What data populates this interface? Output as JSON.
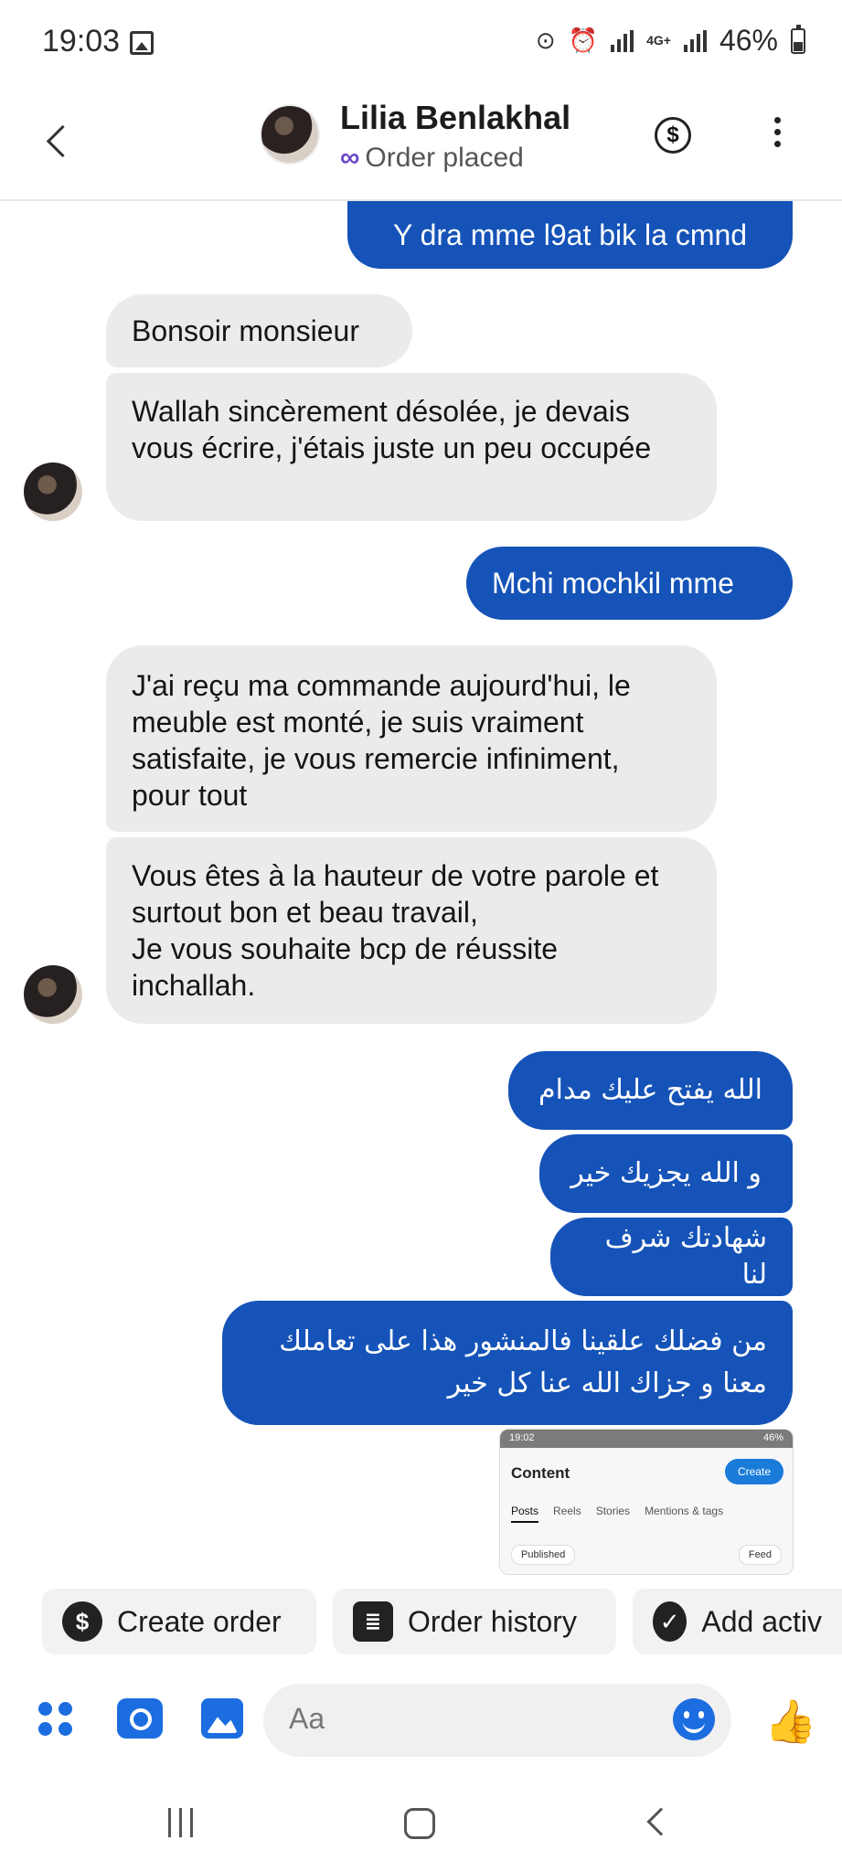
{
  "status": {
    "time": "19:03",
    "net_label": "4G+",
    "battery": "46%"
  },
  "header": {
    "name": "Lilia Benlakhal",
    "subtitle": "Order placed"
  },
  "messages": [
    {
      "dir": "out",
      "text": "Y dra mme l9at bik la cmnd"
    },
    {
      "dir": "in",
      "text": "Bonsoir monsieur"
    },
    {
      "dir": "in",
      "text": "Wallah sincèrement désolée, je devais vous écrire, j'étais juste un peu occupée"
    },
    {
      "dir": "out",
      "text": "Mchi mochkil mme"
    },
    {
      "dir": "in",
      "text": "J'ai reçu ma commande aujourd'hui, le meuble est monté, je suis vraiment satisfaite, je vous remercie infiniment, pour tout"
    },
    {
      "dir": "in",
      "text": "Vous êtes à la hauteur de votre parole et surtout bon et beau travail,\nJe vous souhaite bcp de réussite inchallah."
    },
    {
      "dir": "out",
      "text": "الله يفتح عليك مدام"
    },
    {
      "dir": "out",
      "text": "و الله يجزيك خير"
    },
    {
      "dir": "out",
      "text": "شهادتك شرف لنا"
    },
    {
      "dir": "out",
      "text": "من فضلك علقينا فالمنشور هذا على تعاملك معنا و جزاك الله عنا كل خير"
    }
  ],
  "shared_screenshot": {
    "status_time": "19:02",
    "status_battery": "46%",
    "title": "Content",
    "create_label": "Create",
    "tabs": [
      "Posts",
      "Reels",
      "Stories",
      "Mentions & tags"
    ],
    "filter_label": "Published",
    "feed_label": "Feed"
  },
  "actions": [
    {
      "icon": "dollar-icon",
      "glyph": "$",
      "label": "Create order"
    },
    {
      "icon": "order-history-icon",
      "glyph": "≣",
      "label": "Order history"
    },
    {
      "icon": "check-circle-icon",
      "glyph": "✓",
      "label": "Add activ"
    }
  ],
  "composer": {
    "placeholder": "Aa"
  },
  "colors": {
    "outgoing_bubble": "#1553b8",
    "incoming_bubble": "#ebebeb",
    "accent": "#1b6de0"
  }
}
